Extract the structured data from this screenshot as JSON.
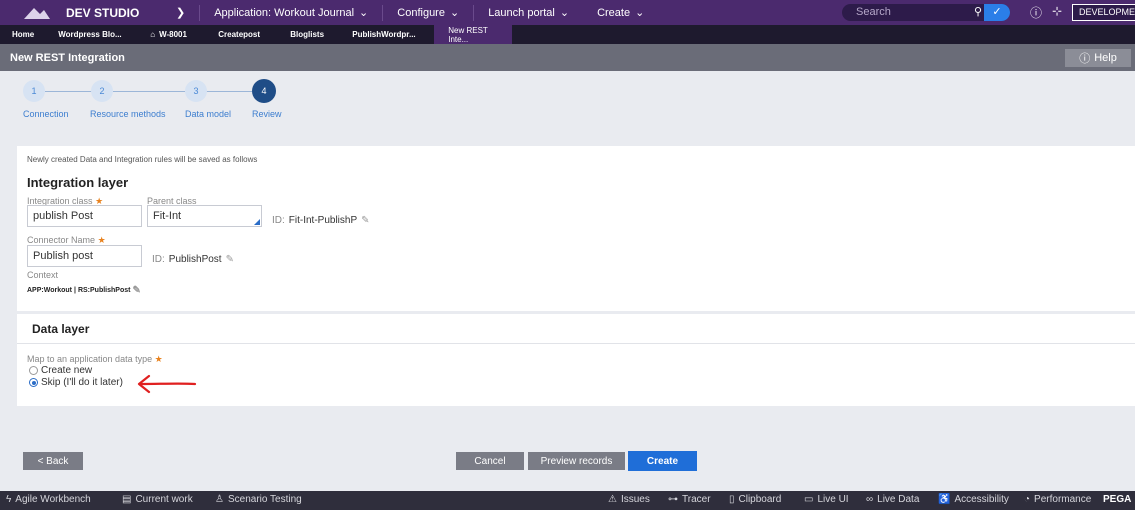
{
  "topbar": {
    "studio": "DEV STUDIO",
    "application": "Application: Workout Journal",
    "configure": "Configure",
    "launch_portal": "Launch portal",
    "create": "Create",
    "search_placeholder": "Search",
    "env_badge": "DEVELOPMENT"
  },
  "tabs": [
    {
      "label": "Home"
    },
    {
      "label": "Wordpress Blo..."
    },
    {
      "label": "W-8001"
    },
    {
      "label": "Createpost"
    },
    {
      "label": "Bloglists"
    },
    {
      "label": "PublishWordpr..."
    },
    {
      "label": "New REST Inte..."
    }
  ],
  "header": {
    "title": "New REST Integration",
    "help": "Help"
  },
  "steps": [
    {
      "num": "1",
      "label": "Connection"
    },
    {
      "num": "2",
      "label": "Resource methods"
    },
    {
      "num": "3",
      "label": "Data model"
    },
    {
      "num": "4",
      "label": "Review",
      "active": true
    }
  ],
  "integration": {
    "note": "Newly created Data and Integration rules will be saved as follows",
    "title": "Integration layer",
    "class_label": "Integration class",
    "class_value": "publish Post",
    "parent_label": "Parent class",
    "parent_value": "Fit-Int",
    "id_prefix": "ID:",
    "class_id": "Fit-Int-PublishP",
    "connector_label": "Connector Name",
    "connector_value": "Publish post",
    "connector_id": "PublishPost",
    "context_label": "Context",
    "context_app": "APP:Workout",
    "context_sep": "|",
    "context_rs": "RS:PublishPost"
  },
  "datalayer": {
    "title": "Data layer",
    "map_label": "Map to an application data type",
    "option_create": "Create new",
    "option_skip": "Skip (I'll do it later)",
    "selected": "skip"
  },
  "buttons": {
    "back": "< Back",
    "cancel": "Cancel",
    "preview": "Preview records",
    "create": "Create"
  },
  "statusbar": {
    "agile": "Agile Workbench",
    "current_work": "Current work",
    "scenario": "Scenario Testing",
    "issues": "Issues",
    "tracer": "Tracer",
    "clipboard": "Clipboard",
    "live_ui": "Live UI",
    "live_data": "Live Data",
    "accessibility": "Accessibility",
    "performance": "Performance",
    "brand": "PEGA"
  },
  "colors": {
    "topbar": "#4b2a6e",
    "accent_blue": "#1f6ed8",
    "required_star": "#e8821e",
    "annotation_arrow": "#e02020"
  }
}
